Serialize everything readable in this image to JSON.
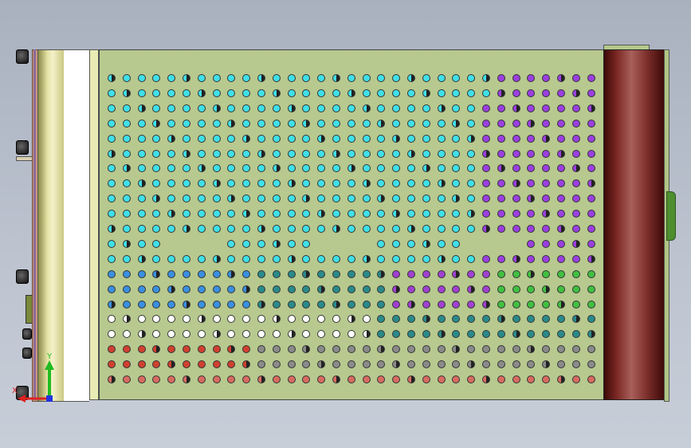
{
  "triad": {
    "x_label": "X",
    "y_label": "Y"
  },
  "colors": {
    "cyan": "#3fe0e8",
    "purple": "#9a3fe0",
    "magenta": "#e040c0",
    "blue": "#3a8fe0",
    "teal": "#2a8a8a",
    "white": "#ffffff",
    "red": "#d04030",
    "green": "#40c040",
    "gray": "#8a8a8a",
    "salmon": "#d86a60",
    "violet": "#a040d0",
    "panel": "#b7c98f"
  }
}
